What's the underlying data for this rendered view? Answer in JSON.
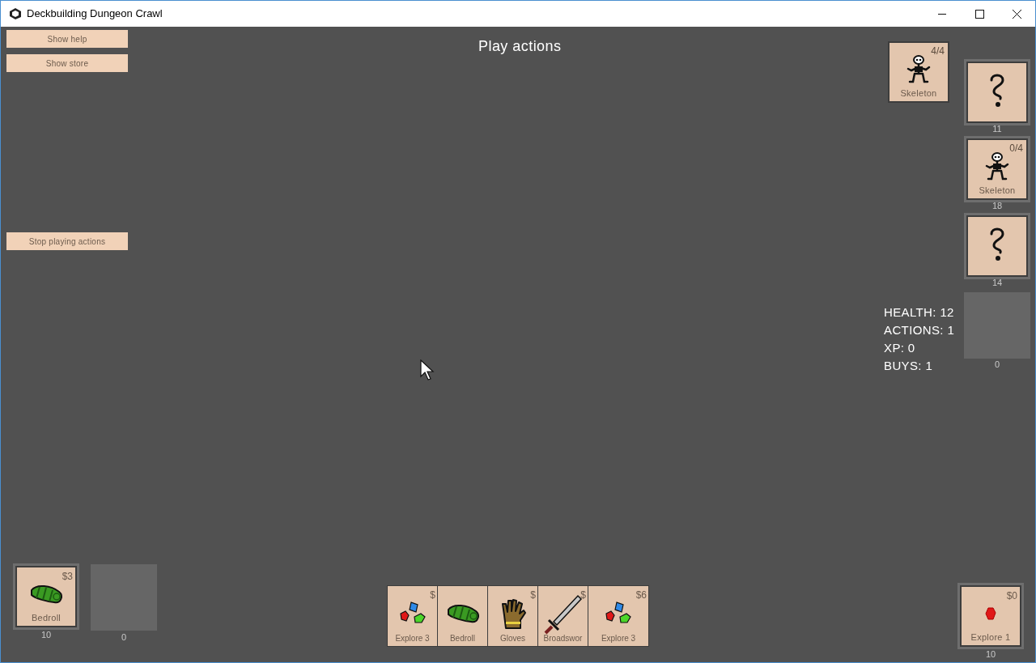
{
  "window": {
    "title": "Deckbuilding Dungeon Crawl"
  },
  "menu_buttons": [
    {
      "label": "Show help"
    },
    {
      "label": "Show store"
    }
  ],
  "phase_title": "Play actions",
  "stop_button": {
    "label": "Stop playing actions"
  },
  "enemy": {
    "kind": "skeleton",
    "value": "4/4",
    "name": "Skeleton"
  },
  "piles": [
    {
      "kind": "hidden",
      "count": "11"
    },
    {
      "kind": "skeleton",
      "value": "0/4",
      "name": "Skeleton",
      "count": "18"
    },
    {
      "kind": "hidden",
      "count": "14"
    },
    {
      "kind": "empty",
      "count": "0"
    }
  ],
  "stats": [
    "HEALTH: 12",
    "ACTIONS: 1",
    "XP: 0",
    "BUYS: 1"
  ],
  "deck": {
    "kind": "bedroll",
    "cost": "$3",
    "name": "Bedroll",
    "count": "10"
  },
  "discard": {
    "kind": "empty",
    "count": "0"
  },
  "hand": [
    {
      "kind": "gems",
      "cost": "$",
      "name": "Explore 3"
    },
    {
      "kind": "bedroll",
      "name": "Bedroll"
    },
    {
      "kind": "gloves",
      "cost": "$",
      "name": "Gloves"
    },
    {
      "kind": "sword",
      "cost": "$",
      "name": "Broadswor"
    },
    {
      "kind": "gems",
      "cost": "$6",
      "name": "Explore 3"
    }
  ],
  "supply": {
    "kind": "ruby",
    "cost": "$0",
    "name": "Explore 1",
    "count": "10"
  }
}
